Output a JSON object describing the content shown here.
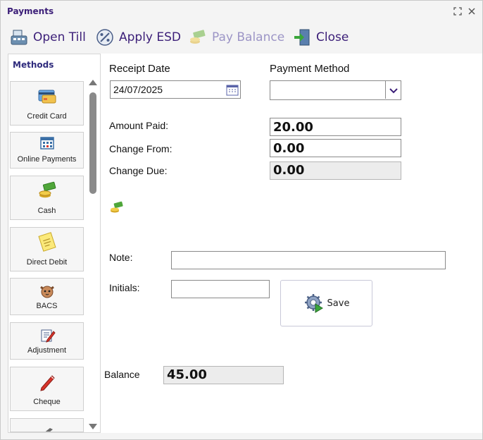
{
  "window": {
    "title": "Payments"
  },
  "toolbar": {
    "open_till": "Open Till",
    "apply_esd": "Apply ESD",
    "pay_balance": "Pay Balance",
    "close": "Close"
  },
  "methods": {
    "title": "Methods",
    "items": [
      {
        "label": "Credit Card",
        "icon": "credit-card-icon"
      },
      {
        "label": "Online Payments",
        "icon": "online-payments-icon"
      },
      {
        "label": "Cash",
        "icon": "cash-icon"
      },
      {
        "label": "Direct Debit",
        "icon": "direct-debit-icon"
      },
      {
        "label": "BACS",
        "icon": "bacs-icon"
      },
      {
        "label": "Adjustment",
        "icon": "adjustment-icon"
      },
      {
        "label": "Cheque",
        "icon": "cheque-icon"
      }
    ]
  },
  "form": {
    "receipt_date_label": "Receipt Date",
    "receipt_date_value": "24/07/2025",
    "payment_method_label": "Payment Method",
    "payment_method_value": "",
    "amount_paid_label": "Amount Paid:",
    "amount_paid_value": "20.00",
    "change_from_label": "Change From:",
    "change_from_value": "0.00",
    "change_due_label": "Change Due:",
    "change_due_value": "0.00",
    "note_label": "Note:",
    "note_value": "",
    "initials_label": "Initials:",
    "initials_value": "",
    "save_label": "Save",
    "balance_label": "Balance",
    "balance_value": "45.00"
  },
  "colors": {
    "accent": "#3b1e78",
    "disabled_accent": "#9c95c6"
  }
}
